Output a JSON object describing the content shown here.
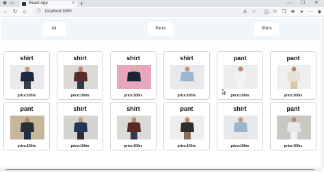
{
  "browser": {
    "tab_title": "React App",
    "new_tab_symbol": "+",
    "url": "localhost:3000",
    "minimize_symbol": "—",
    "maximize_symbol": "☐",
    "close_symbol": "✕"
  },
  "filters": [
    {
      "label": "All"
    },
    {
      "label": "Pants"
    },
    {
      "label": "Shirts"
    }
  ],
  "products": [
    {
      "title": "shirt",
      "price": "price:100rs",
      "bg": "#e9e9ee",
      "top": "#1c2740",
      "bottom": "#3a3f4e",
      "skin": "#c89a7b"
    },
    {
      "title": "shirt",
      "price": "price:100rs",
      "bg": "#dcdad6",
      "top": "#5a2a2a",
      "bottom": "#2f3a4a",
      "skin": "#b98a6a"
    },
    {
      "title": "shirt",
      "price": "price:100rs",
      "bg": "#e8a6bd",
      "top": "#1d2336",
      "bottom": "#e8a6bd",
      "skin": "#d9b09a"
    },
    {
      "title": "shirt",
      "price": "price:100rs",
      "bg": "#e7e9ec",
      "top": "#9bb6cf",
      "bottom": "#e8e8e8",
      "skin": "#c49a7e"
    },
    {
      "title": "pant",
      "price": "price:100rs",
      "bg": "#ececec",
      "top": "#f2f2f2",
      "bottom": "#f4f4f4",
      "skin": "#b78a70"
    },
    {
      "title": "pant",
      "price": "price:100rs",
      "bg": "#efefef",
      "top": "#e8e2d6",
      "bottom": "#d8c9a8",
      "skin": "#b78a70"
    },
    {
      "title": "pant",
      "price": "price:100rs",
      "bg": "#c7b79a",
      "top": "#2a2f3a",
      "bottom": "#1f2e4a",
      "skin": "#b98a6a"
    },
    {
      "title": "shirt",
      "price": "price:100rs",
      "bg": "#d6d4d0",
      "top": "#243557",
      "bottom": "#2a2f3a",
      "skin": "#c89a7b"
    },
    {
      "title": "shirt",
      "price": "price:100rs",
      "bg": "#dcdad6",
      "top": "#5a2a2a",
      "bottom": "#2f3a4a",
      "skin": "#b98a6a"
    },
    {
      "title": "pant",
      "price": "price:100rs",
      "bg": "#eeeeee",
      "top": "#2f2f2f",
      "bottom": "#8a6f56",
      "skin": "#b98a6a"
    },
    {
      "title": "shirt",
      "price": "price:100rs",
      "bg": "#e7e9ec",
      "top": "#9bb6cf",
      "bottom": "#e8e8e8",
      "skin": "#c49a7e"
    },
    {
      "title": "pant",
      "price": "price:100rs",
      "bg": "#c9c7c2",
      "top": "#e9e9e9",
      "bottom": "#f2f2f2",
      "skin": "#b78a70"
    }
  ]
}
